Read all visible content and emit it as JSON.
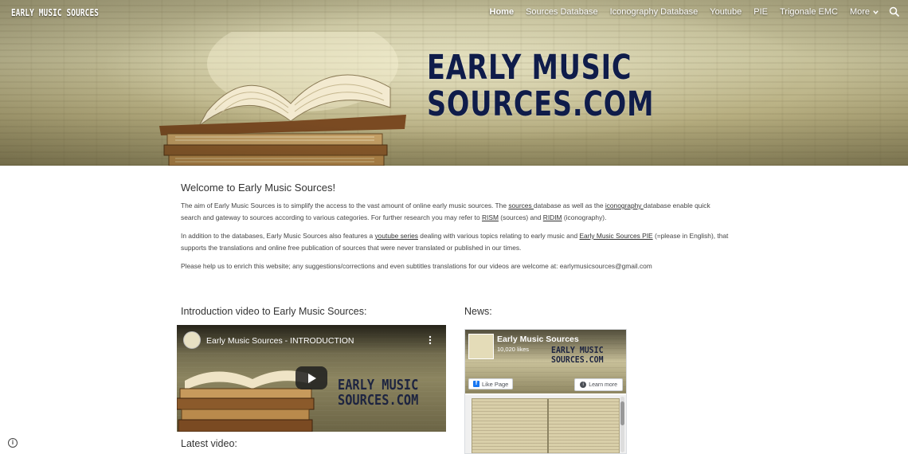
{
  "site": {
    "name": "EARLY MUSIC SOURCES",
    "banner_logo_line1": "EARLY MUSIC",
    "banner_logo_line2": "SOURCES.COM"
  },
  "nav": {
    "items": [
      {
        "label": "Home",
        "active": true
      },
      {
        "label": "Sources Database",
        "active": false
      },
      {
        "label": "Iconography Database",
        "active": false
      },
      {
        "label": "Youtube",
        "active": false
      },
      {
        "label": "PIE",
        "active": false
      },
      {
        "label": "Trigonale EMC",
        "active": false
      }
    ],
    "more_label": "More",
    "search_icon": "search-icon"
  },
  "welcome": {
    "title": "Welcome to Early Music Sources!",
    "p1": {
      "t1": "The aim of Early Music Sources is to simplify the access to the vast amount of online early music sources. The ",
      "link_sources": "sources ",
      "t2": "database as well as the ",
      "link_iconography": "iconography ",
      "t3": "database enable quick search and gateway to sources according to various categories. For further research you may refer to ",
      "link_rism": "RISM",
      "t4": " (sources) and ",
      "link_ridim": "RIDIM",
      "t5": " (iconography)."
    },
    "p2": {
      "t1": "In addition to the databases, Early Music Sources also features a ",
      "link_youtube": "youtube series",
      "t2": " dealing with various topics relating to early music and ",
      "link_pie": "Early Music Sources PIE",
      "t3": " (=please in English), that supports the translations and online free publication of sources that were never translated or published in our times."
    },
    "p3": "Please help us to enrich this website; any suggestions/corrections and even subtitles translations for our videos are welcome at: earlymusicsources@gmail.com"
  },
  "intro_video": {
    "heading": "Introduction video to Early Music Sources:",
    "title": "Early Music Sources - INTRODUCTION",
    "logo_line1": "EARLY MUSIC",
    "logo_line2": "SOURCES.COM"
  },
  "news": {
    "heading": "News:",
    "page_name": "Early Music Sources",
    "likes": "10,020 likes",
    "cover_logo_line1": "EARLY MUSIC",
    "cover_logo_line2": "SOURCES.COM",
    "like_button": "Like Page",
    "learn_more": "Learn more"
  },
  "latest_video": {
    "heading": "Latest video:"
  },
  "colors": {
    "logo_navy": "#0f1c4a",
    "fb_blue": "#1877f2"
  }
}
